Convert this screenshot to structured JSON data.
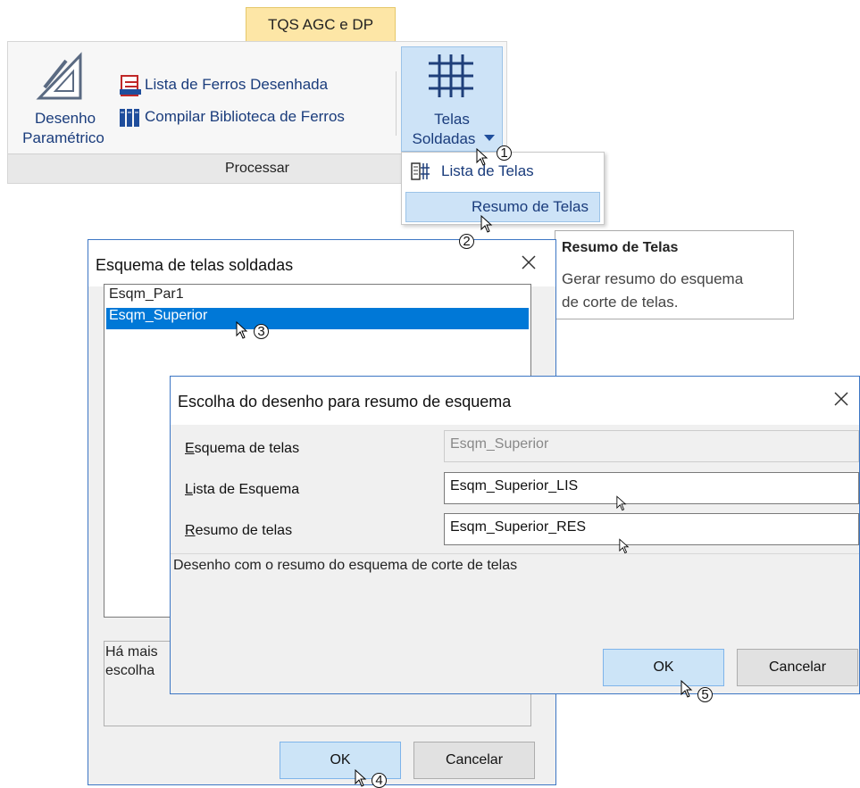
{
  "ribbon": {
    "tab_label": "TQS AGC e DP",
    "desenho_line1": "Desenho",
    "desenho_line2": "Paramétrico",
    "lista_ferros": "Lista de Ferros Desenhada",
    "compilar": "Compilar Biblioteca de Ferros",
    "telas_line1": "Telas",
    "telas_line2": "Soldadas",
    "group_label": "Processar"
  },
  "dropdown": {
    "items": [
      {
        "label": "Lista de Telas",
        "icon": "grid-list-icon"
      },
      {
        "label": "Resumo de Telas"
      }
    ]
  },
  "tooltip": {
    "title": "Resumo de Telas",
    "line1": "Gerar resumo do esquema",
    "line2": "de corte de telas."
  },
  "dialog_esquema": {
    "title": "Esquema de telas soldadas",
    "items": [
      "Esqm_Par1",
      "Esqm_Superior"
    ],
    "selected_index": 1,
    "message_line1": "Há mais",
    "message_line2": "escolha",
    "ok": "OK",
    "cancel": "Cancelar"
  },
  "dialog_escolha": {
    "title": "Escolha do desenho para resumo de esquema",
    "esquema_label_key": "E",
    "esquema_label_rest": "squema de telas",
    "esquema_value": "Esqm_Superior",
    "lista_label_key": "L",
    "lista_label_rest": "ista de Esquema",
    "lista_value": "Esqm_Superior_LIS",
    "resumo_label_key": "R",
    "resumo_label_rest": "esumo de telas",
    "resumo_value": "Esqm_Superior_RES",
    "description": "Desenho com o resumo do esquema de corte de telas",
    "ok": "OK",
    "cancel": "Cancelar"
  },
  "callouts": [
    "1",
    "2",
    "3",
    "4",
    "5"
  ],
  "colors": {
    "accent": "#3c76c4",
    "selection": "#0078d7",
    "ribbon_tab": "#fde6a6",
    "hover": "#cde3f7"
  }
}
